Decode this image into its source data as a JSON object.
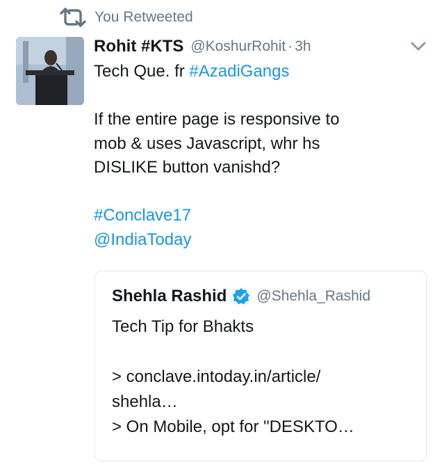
{
  "retweet": {
    "label": "You Retweeted"
  },
  "tweet": {
    "author_name": "Rohit #KTS",
    "author_handle": "@KoshurRohit",
    "separator": "·",
    "timestamp": "3h",
    "lines": {
      "l1_text": "Tech Que. fr ",
      "l1_hashtag": "#AzadiGangs",
      "l2": "If the entire page is responsive to",
      "l3": "mob & uses Javascript, whr hs",
      "l4": "DISLIKE button vanishd?",
      "hashtag_conclave": "#Conclave17",
      "mention_indiatoday": "@IndiaToday"
    }
  },
  "quoted_tweet": {
    "author_name": "Shehla Rashid",
    "author_handle": "@Shehla_Rashid",
    "lines": {
      "l1": "Tech Tip for Bhakts",
      "l2": "> conclave.intoday.in/article/",
      "l3": "shehla…",
      "l4": "> On Mobile, opt for \"DESKTO…"
    }
  },
  "colors": {
    "link": "#1b95e0",
    "secondary_text": "#657786",
    "primary_text": "#14171a",
    "verified": "#1da1f2",
    "card_border": "#e1e8ed"
  },
  "icons": {
    "retweet": "retweet-icon",
    "caret": "chevron-down-icon",
    "verified": "verified-badge-icon"
  }
}
